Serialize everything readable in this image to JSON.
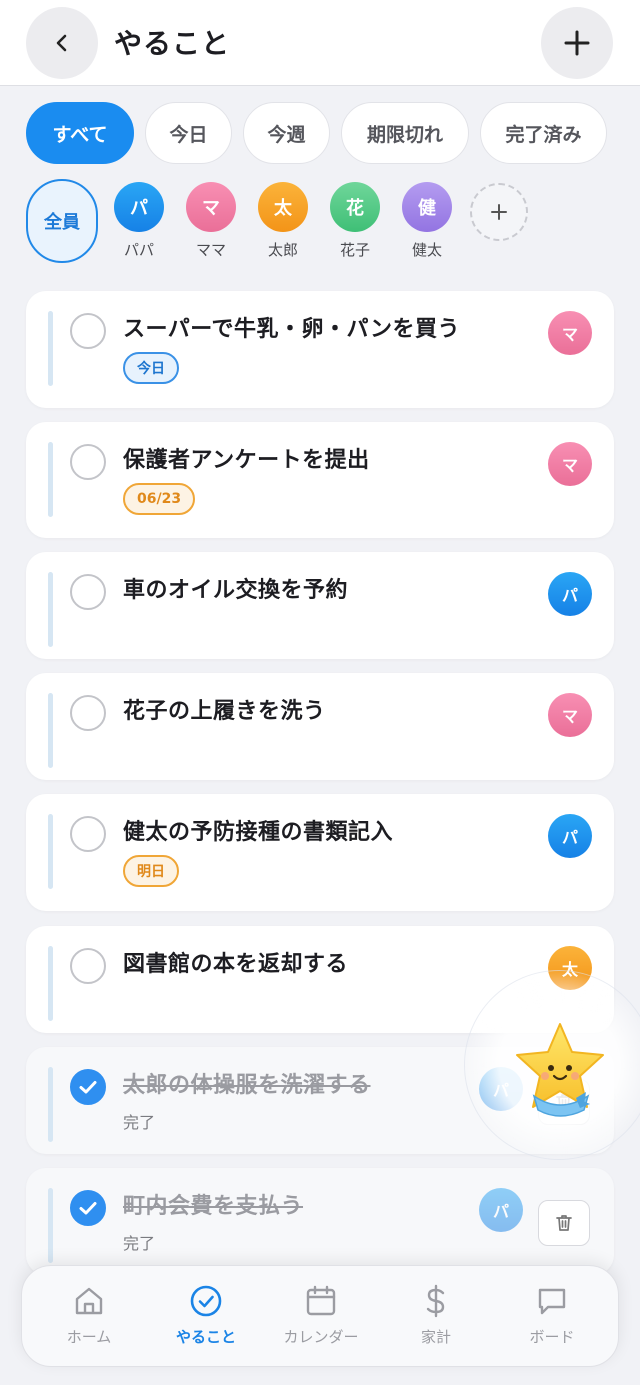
{
  "header": {
    "title": "やること",
    "back_icon": "chevron-left-icon",
    "add_icon": "plus-icon"
  },
  "filters": [
    {
      "label": "すべて",
      "active": true
    },
    {
      "label": "今日",
      "active": false
    },
    {
      "label": "今週",
      "active": false
    },
    {
      "label": "期限切れ",
      "active": false
    },
    {
      "label": "完了済み",
      "active": false
    }
  ],
  "members": {
    "all_label": "全員",
    "people": [
      {
        "initial": "パ",
        "name": "パパ",
        "color_from": "#2aa6f5",
        "color_to": "#1681e6"
      },
      {
        "initial": "マ",
        "name": "ママ",
        "color_from": "#f88fb3",
        "color_to": "#ea6f98"
      },
      {
        "initial": "太",
        "name": "太郎",
        "color_from": "#fbb33a",
        "color_to": "#f39418"
      },
      {
        "initial": "花",
        "name": "花子",
        "color_from": "#6fd69a",
        "color_to": "#3fbf76"
      },
      {
        "initial": "健",
        "name": "健太",
        "color_from": "#b49cf0",
        "color_to": "#9374e2"
      }
    ]
  },
  "tasks": [
    {
      "title": "スーパーで牛乳・卵・パンを買う",
      "badge": "今日",
      "badge_style": "blue",
      "owner": "マ",
      "done": false
    },
    {
      "title": "保護者アンケートを提出",
      "badge": "06/23",
      "badge_style": "orange",
      "owner": "マ",
      "done": false
    },
    {
      "title": "車のオイル交換を予約",
      "badge": "",
      "owner": "パ",
      "done": false
    },
    {
      "title": "花子の上履きを洗う",
      "badge": "",
      "owner": "マ",
      "done": false
    },
    {
      "title": "健太の予防接種の書類記入",
      "badge": "明日",
      "badge_style": "orange",
      "owner": "パ",
      "done": false
    },
    {
      "title": "図書館の本を返却する",
      "badge": "",
      "owner": "太",
      "done": false
    },
    {
      "title": "太郎の体操服を洗濯する",
      "status": "完了",
      "owner": "パ",
      "done": true
    },
    {
      "title": "町内会費を支払う",
      "status": "完了",
      "owner": "パ",
      "done": true
    }
  ],
  "nav": [
    {
      "label": "ホーム",
      "icon": "home-icon",
      "active": false
    },
    {
      "label": "やること",
      "icon": "check-circle-icon",
      "active": true
    },
    {
      "label": "カレンダー",
      "icon": "calendar-icon",
      "active": false
    },
    {
      "label": "家計",
      "icon": "dollar-icon",
      "active": false
    },
    {
      "label": "ボード",
      "icon": "chat-bubble-icon",
      "active": false
    }
  ],
  "colors": {
    "accent": "#1a8cf0",
    "background": "#f1f2f6"
  }
}
